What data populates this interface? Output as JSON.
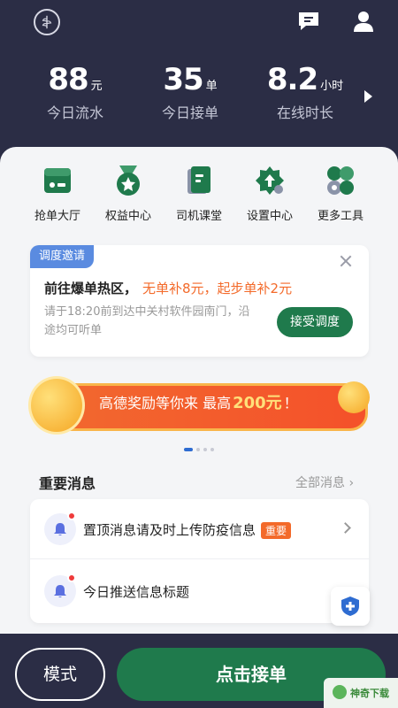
{
  "stats": [
    {
      "value": "88",
      "unit": "元",
      "label": "今日流水"
    },
    {
      "value": "35",
      "unit": "单",
      "label": "今日接单"
    },
    {
      "value": "8.2",
      "unit": "小时",
      "label": "在线时长"
    }
  ],
  "quick_actions": [
    {
      "label": "抢单大厅",
      "icon": "order-hall-icon"
    },
    {
      "label": "权益中心",
      "icon": "medal-icon"
    },
    {
      "label": "司机课堂",
      "icon": "book-icon"
    },
    {
      "label": "设置中心",
      "icon": "settings-gear-icon"
    },
    {
      "label": "更多工具",
      "icon": "more-tools-icon"
    }
  ],
  "invite": {
    "tag": "调度邀请",
    "title": "前往爆单热区，",
    "highlight": "无单补8元，起步单补2元",
    "desc": "请于18:20前到达中关村软件园南门，沿途均可听单",
    "accept_label": "接受调度"
  },
  "banner": {
    "text_pre": "高德奖励等你来 最高",
    "amount": "200元",
    "text_post": "！"
  },
  "messages": {
    "title": "重要消息",
    "all_label": "全部消息",
    "items": [
      {
        "text": "置顶消息请及时上传防疫信息",
        "badge": "重要"
      },
      {
        "text": "今日推送信息标题"
      }
    ]
  },
  "bottom": {
    "mode_label": "模式",
    "go_label": "点击接单"
  },
  "watermark": "神奇下载",
  "colors": {
    "header_bg": "#2b2d45",
    "accent_green": "#1f7a4c",
    "highlight_orange": "#f36a2a",
    "tag_blue": "#5a8be0"
  }
}
